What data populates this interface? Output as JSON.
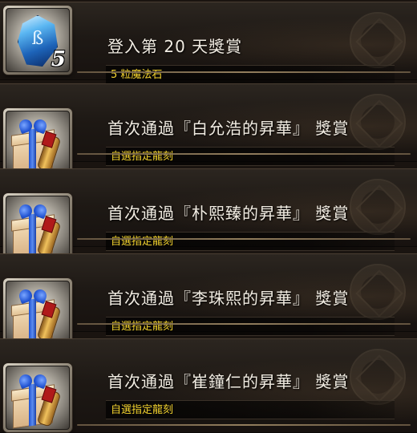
{
  "rewards": [
    {
      "title": "登入第 20 天獎賞",
      "detail": "5 粒魔法石",
      "icon": "magic-stone-icon",
      "quantity": "5"
    },
    {
      "title": "首次通過『白允浩的昇華』 獎賞",
      "detail": "自選指定龍刻",
      "icon": "gift-box-icon"
    },
    {
      "title": "首次通過『朴熙臻的昇華』 獎賞",
      "detail": "自選指定龍刻",
      "icon": "gift-box-icon"
    },
    {
      "title": "首次通過『李珠熙的昇華』 獎賞",
      "detail": "自選指定龍刻",
      "icon": "gift-box-icon"
    },
    {
      "title": "首次通過『崔鐘仁的昇華』 獎賞",
      "detail": "自選指定龍刻",
      "icon": "gift-box-icon"
    }
  ],
  "colors": {
    "title_text": "#f1ece2",
    "detail_text": "#f2d22e",
    "panel_bg": "#1e1915"
  }
}
